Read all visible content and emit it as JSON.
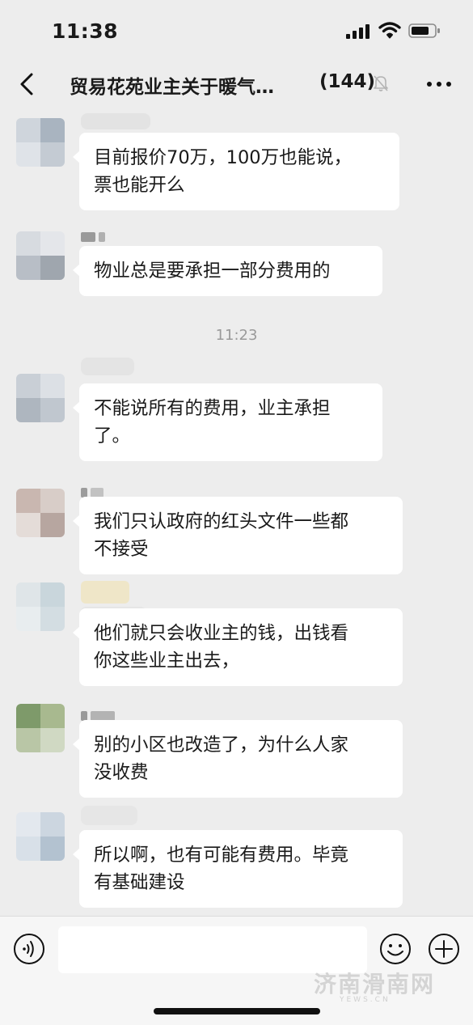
{
  "status_bar": {
    "time": "11:38"
  },
  "header": {
    "title": "贸易花苑业主关于暖气…",
    "member_count": "(144)"
  },
  "messages": [
    {
      "text_lines": [
        "目前报价70万，100万也能说，",
        "票也能开么"
      ]
    },
    {
      "text_lines": [
        "物业总是要承担一部分费用的"
      ]
    },
    {
      "text_lines": [
        "不能说所有的费用，业主承担",
        "了。"
      ]
    },
    {
      "text_lines": [
        "我们只认政府的红头文件一些都",
        "不接受"
      ]
    },
    {
      "text_lines": [
        "他们就只会收业主的钱，出钱看",
        "你这些业主出去，"
      ]
    },
    {
      "text_lines": [
        "别的小区也改造了，为什么人家",
        "没收费"
      ]
    },
    {
      "text_lines": [
        "所以啊，也有可能有费用。毕竟",
        "有基础建设"
      ]
    }
  ],
  "timestamp": "11:23",
  "watermark": {
    "text": "济南滑南网",
    "sub": "YEWS.CN"
  },
  "icons": [
    "back-arrow-icon",
    "mute-bell-icon",
    "more-dots-icon",
    "voice-icon",
    "emoji-icon",
    "plus-icon"
  ]
}
